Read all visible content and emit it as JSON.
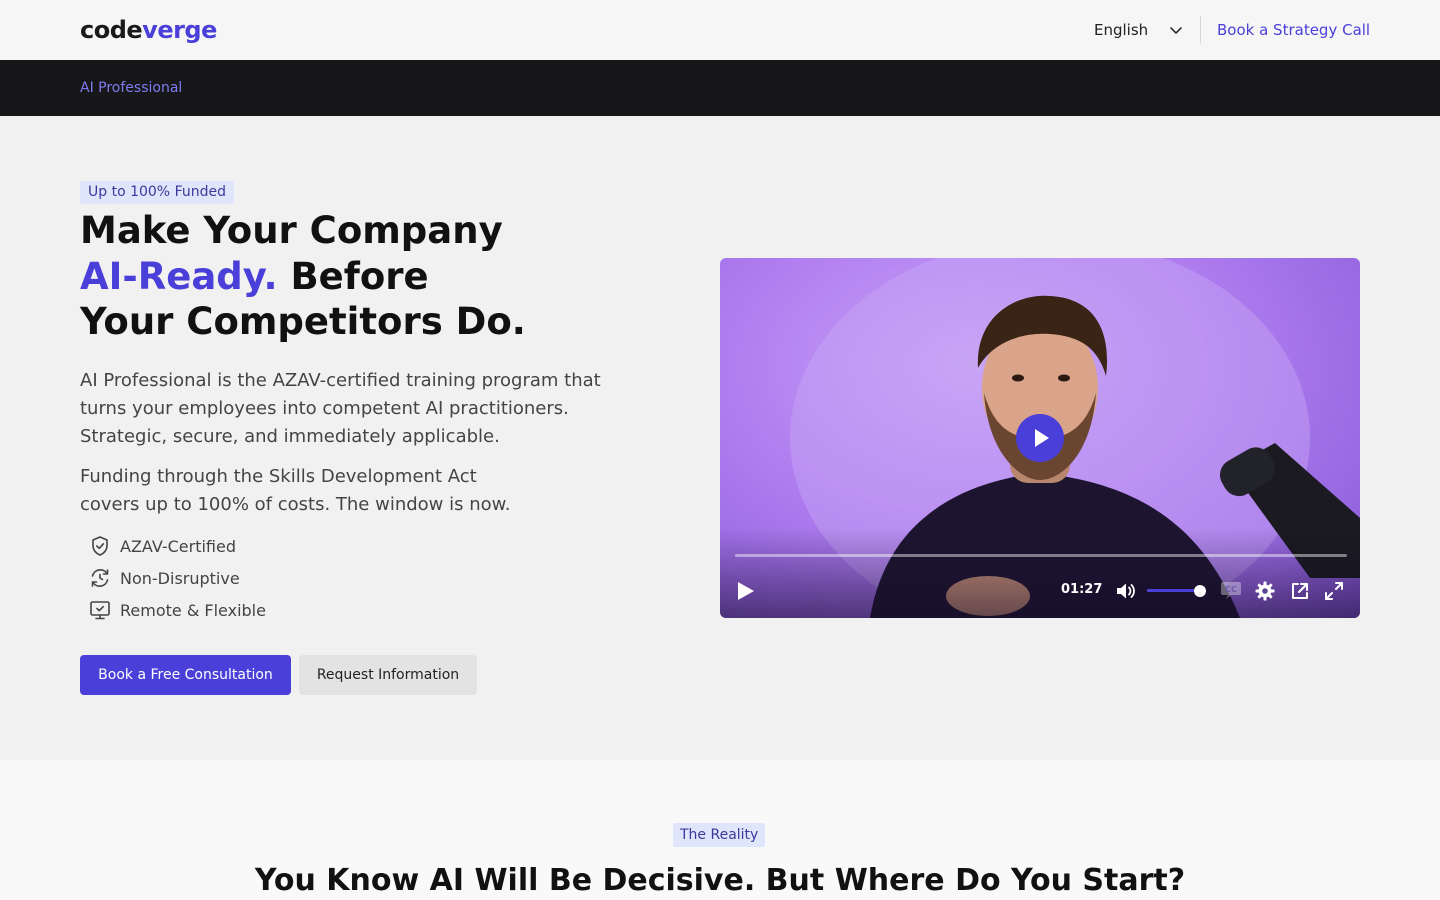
{
  "header": {
    "logo_part1": "code",
    "logo_part2": "verge",
    "language": "English",
    "cta": "Book a Strategy Call"
  },
  "subnav": {
    "item": "AI Professional"
  },
  "hero": {
    "badge": "Up to 100% Funded",
    "title_line1": "Make Your Company",
    "title_accent": "AI-Ready.",
    "title_line2_rest": " Before",
    "title_line3": "Your Competitors Do.",
    "paragraph1": "AI Professional is the AZAV-certified training program that turns your employees into competent AI practitioners. Strategic, secure, and immediately applicable.",
    "paragraph2": "Funding through the Skills Development Act covers up to 100% of costs. The window is now.",
    "features": [
      {
        "label": "AZAV-Certified",
        "icon": "shield-check-icon"
      },
      {
        "label": "Non-Disruptive",
        "icon": "refresh-clock-icon"
      },
      {
        "label": "Remote & Flexible",
        "icon": "monitor-check-icon"
      }
    ],
    "primary_button": "Book a Free Consultation",
    "secondary_button": "Request Information"
  },
  "video": {
    "time": "01:27",
    "progress_fraction": 0,
    "volume_fraction": 1.0,
    "icons": [
      "play-icon",
      "volume-icon",
      "captions-icon",
      "settings-icon",
      "pip-icon",
      "fullscreen-icon"
    ]
  },
  "section2": {
    "badge": "The Reality",
    "title": "You Know AI Will Be Decisive. But Where Do You Start?"
  },
  "colors": {
    "accent": "#4a3fd8",
    "dark_nav": "#17171a",
    "badge_bg": "#dfe5fb"
  }
}
